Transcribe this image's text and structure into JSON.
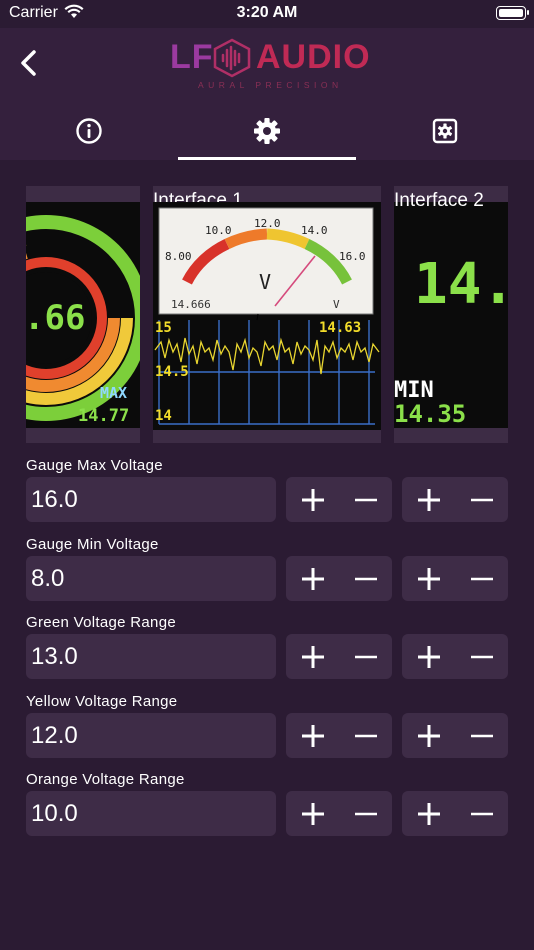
{
  "status": {
    "carrier": "Carrier",
    "time": "3:20 AM"
  },
  "header": {
    "logo": {
      "left": "LF",
      "right": "AUDIO",
      "tagline": "AURAL PRECISION"
    },
    "tabs": [
      {
        "icon": "info-icon"
      },
      {
        "icon": "gear-icon",
        "selected": true
      },
      {
        "icon": "settings-box-icon"
      }
    ]
  },
  "preview": {
    "cards": [
      {
        "title": "",
        "big_value": ".66",
        "label": "MAX",
        "value": "14.77"
      },
      {
        "title": "Interface 1",
        "meter": {
          "scale": [
            "8.00",
            "10.0",
            "12.0",
            "14.0",
            "16.0"
          ],
          "unit": "V",
          "reading": "14.666",
          "unit_small": "V"
        },
        "graph": {
          "top_left": "15",
          "top_right": "14.63",
          "mid": "14.5",
          "bottom": "14"
        }
      },
      {
        "title": "Interface 2",
        "big_value": "14.",
        "label": "MIN",
        "value": "14.35"
      }
    ]
  },
  "rows": [
    {
      "label": "Gauge Max Voltage",
      "value": "16.0"
    },
    {
      "label": "Gauge Min Voltage",
      "value": "8.0"
    },
    {
      "label": "Green Voltage Range",
      "value": "13.0"
    },
    {
      "label": "Yellow Voltage Range",
      "value": "12.0"
    },
    {
      "label": "Orange Voltage Range",
      "value": "10.0"
    }
  ],
  "colors": {
    "background": "#2b1b33",
    "header": "#34203d",
    "field": "#3e2c47",
    "lcd_green": "#8be04a",
    "lcd_yellow": "#f2dc2a",
    "lcd_cyan": "#8fd8ff"
  }
}
